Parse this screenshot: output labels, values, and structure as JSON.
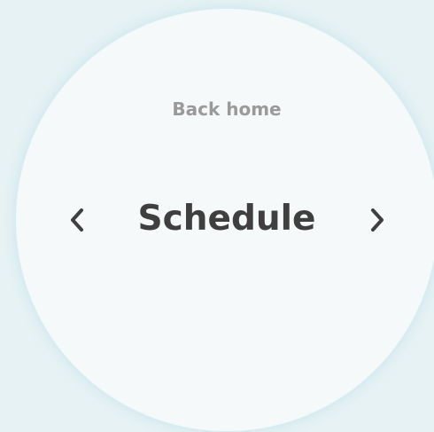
{
  "nav": {
    "back_label": "Back home",
    "prev_icon": "chevron-left-icon",
    "next_icon": "chevron-right-icon"
  },
  "screen": {
    "title": "Schedule"
  },
  "colors": {
    "background": "#e6f2f4",
    "dial": "#f6f9fa",
    "dial_edge": "#d7edf1",
    "title": "#3f3f3f",
    "secondary": "#9a9a9a"
  }
}
